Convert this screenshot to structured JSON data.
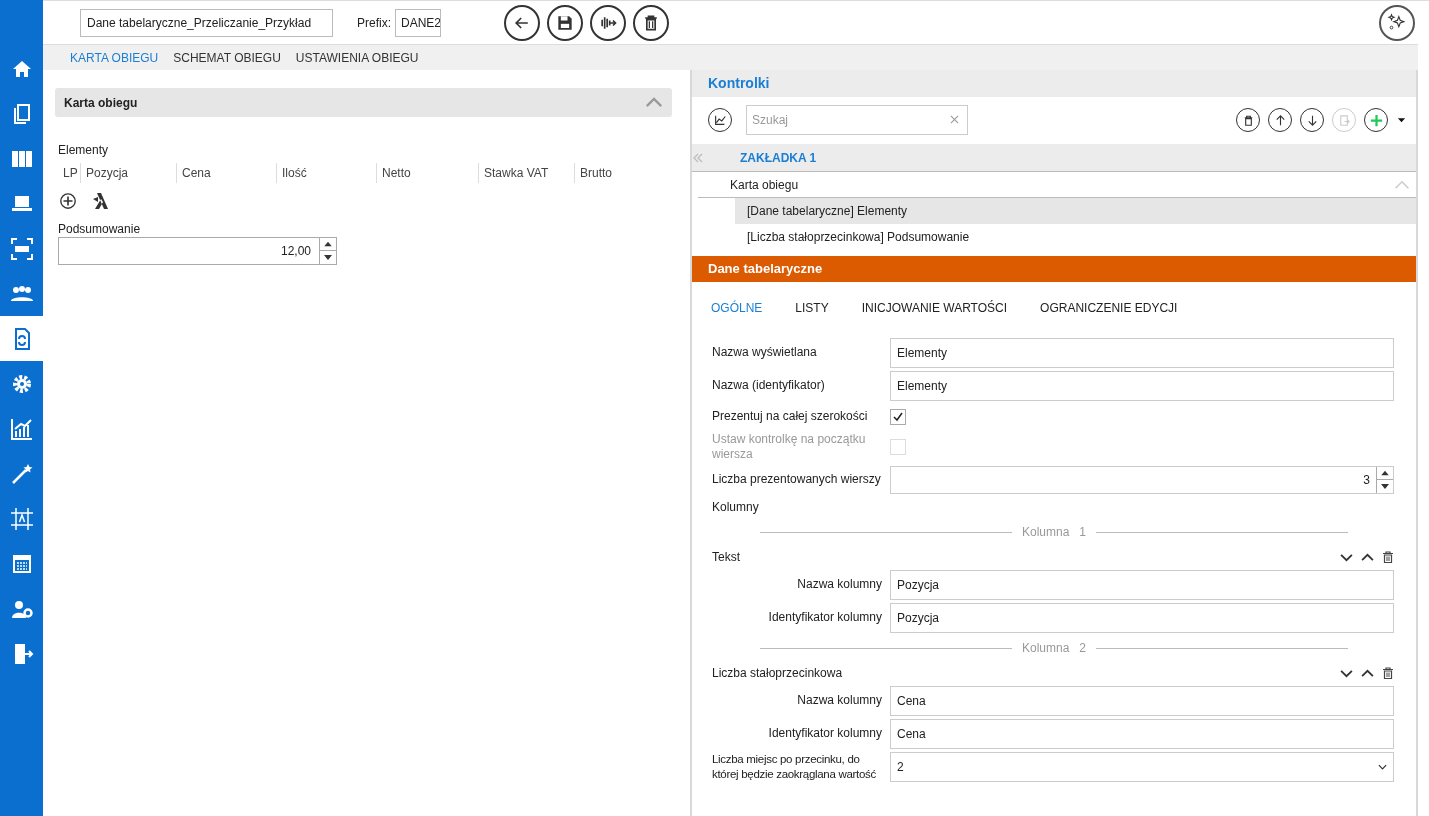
{
  "header": {
    "title_value": "Dane tabelaryczne_Przeliczanie_Przykład",
    "prefix_label": "Prefix:",
    "prefix_value": "DANE2"
  },
  "sidebar": {
    "items": [
      {
        "selected": false
      },
      {
        "selected": false
      },
      {
        "selected": false
      },
      {
        "selected": false
      },
      {
        "selected": false
      },
      {
        "selected": false
      },
      {
        "selected": true
      },
      {
        "selected": false
      },
      {
        "selected": false
      },
      {
        "selected": false
      },
      {
        "selected": false
      },
      {
        "selected": false
      },
      {
        "selected": false
      },
      {
        "selected": false
      }
    ]
  },
  "tabs": [
    {
      "label": "KARTA OBIEGU",
      "selected": true
    },
    {
      "label": "SCHEMAT OBIEGU",
      "selected": false
    },
    {
      "label": "USTAWIENIA OBIEGU",
      "selected": false
    }
  ],
  "card": {
    "title": "Karta obiegu",
    "expanded": true,
    "table_label": "Elementy",
    "columns": [
      "LP",
      "Pozycja",
      "Cena",
      "Ilość",
      "Netto",
      "Stawka VAT",
      "Brutto"
    ],
    "summary": {
      "label": "Podsumowanie",
      "value": "12,00"
    }
  },
  "controls": {
    "title": "Kontrolki",
    "search": {
      "placeholder": "Szukaj"
    },
    "page_tab": "ZAKŁADKA 1",
    "tree": {
      "label": "Karta obiegu",
      "expanded": true,
      "children": [
        {
          "label": "[Dane tabelaryczne] Elementy",
          "selected": true
        },
        {
          "label": "[Liczba stałoprzecinkowa] Podsumowanie",
          "selected": false
        }
      ]
    }
  },
  "properties": {
    "title": "Dane tabelaryczne",
    "tabs": [
      {
        "label": "OGÓLNE",
        "selected": true
      },
      {
        "label": "LISTY",
        "selected": false
      },
      {
        "label": "INICJOWANIE WARTOŚCI",
        "selected": false
      },
      {
        "label": "OGRANICZENIE EDYCJI",
        "selected": false
      }
    ],
    "fields": [
      {
        "kind": "text",
        "label": "Nazwa wyświetlana",
        "value": "Elementy"
      },
      {
        "kind": "text",
        "label": "Nazwa (identyfikator)",
        "value": "Elementy"
      },
      {
        "kind": "checkbox",
        "label": "Prezentuj na całej szerokości",
        "checked": true,
        "disabled": false
      },
      {
        "kind": "checkbox",
        "label": "Ustaw kontrolkę na początku wiersza",
        "checked": false,
        "disabled": true
      },
      {
        "kind": "spinner",
        "label": "Liczba prezentowanych wierszy",
        "value": "3"
      }
    ],
    "columns_label": "Kolumny",
    "columns": [
      {
        "divider_label": "Kolumna",
        "number": "1",
        "type": "Tekst",
        "fields": [
          {
            "kind": "text",
            "label": "Nazwa kolumny",
            "value": "Pozycja"
          },
          {
            "kind": "text",
            "label": "Identyfikator kolumny",
            "value": "Pozycja"
          }
        ]
      },
      {
        "divider_label": "Kolumna",
        "number": "2",
        "type": "Liczba stałoprzecinkowa",
        "fields": [
          {
            "kind": "text",
            "label": "Nazwa kolumny",
            "value": "Cena"
          },
          {
            "kind": "text",
            "label": "Identyfikator kolumny",
            "value": "Cena"
          },
          {
            "kind": "select",
            "label": "Liczba miejsc po przecinku, do której będzie zaokrąglana wartość",
            "value": "2"
          }
        ]
      }
    ]
  }
}
